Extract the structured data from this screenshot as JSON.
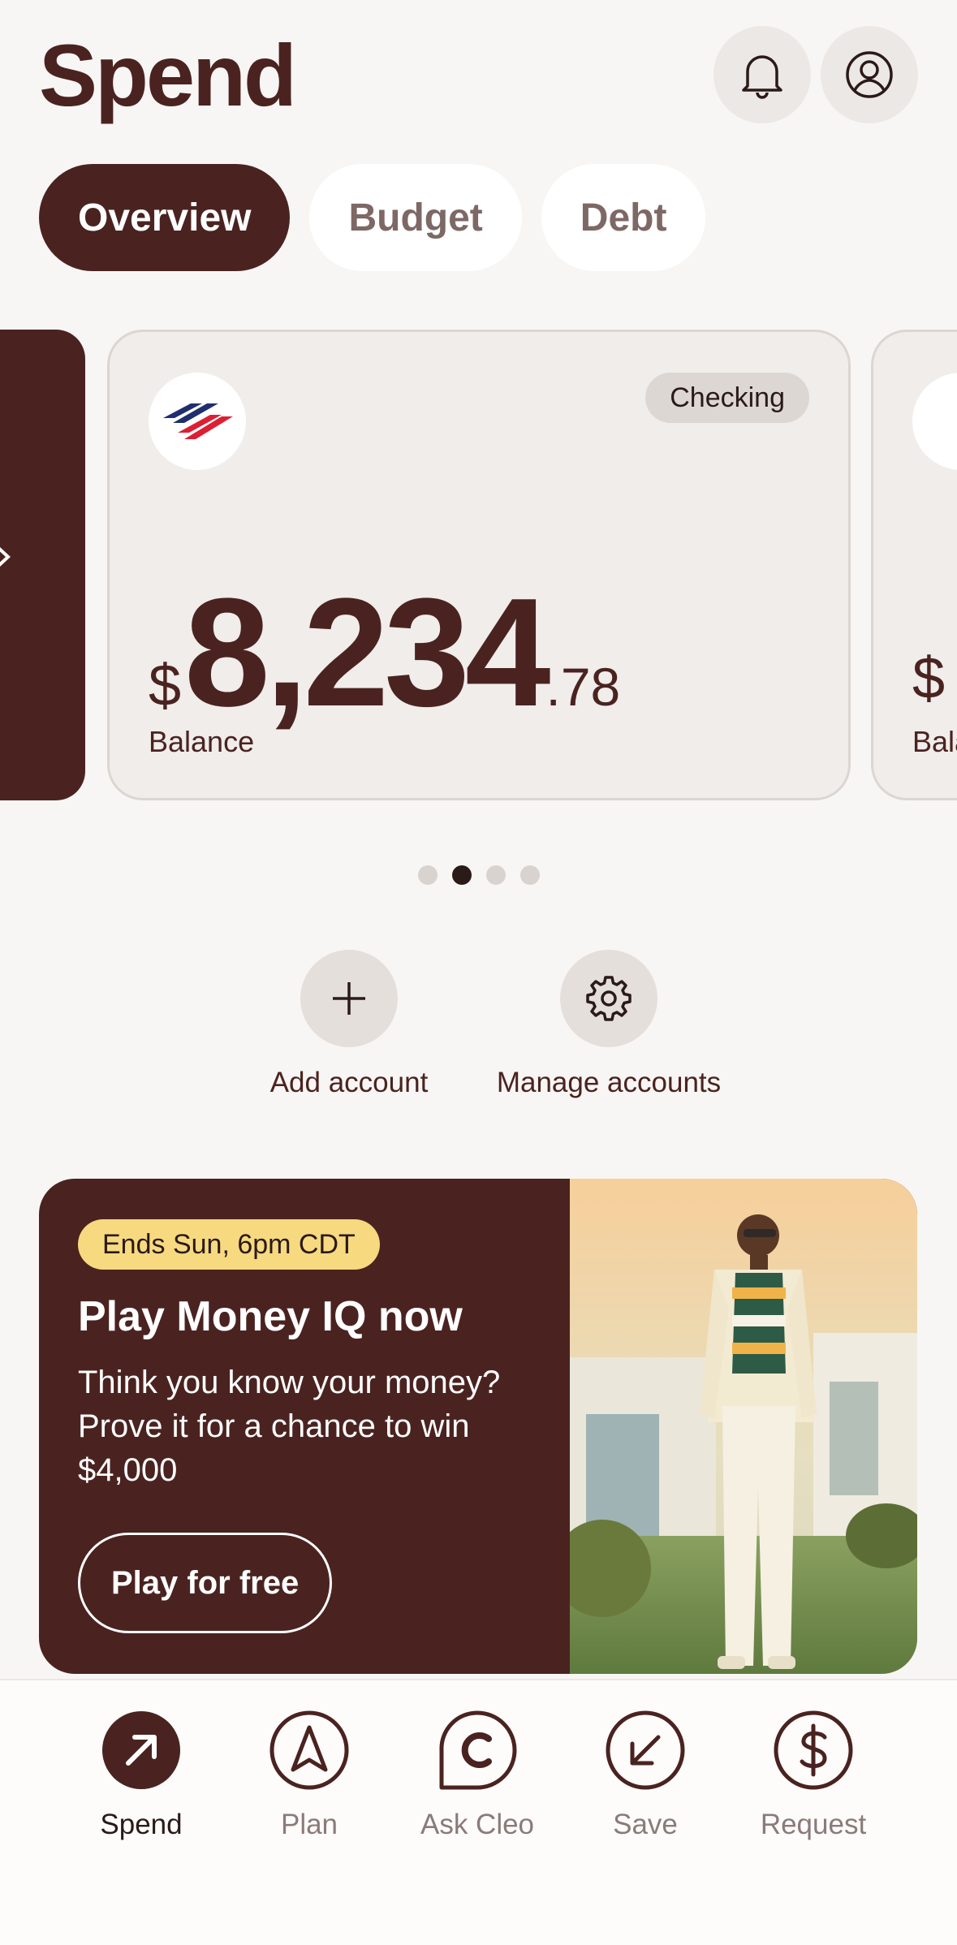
{
  "header": {
    "title": "Spend",
    "icons": {
      "notifications": "bell-icon",
      "profile": "profile-icon"
    }
  },
  "tabs": [
    {
      "label": "Overview",
      "active": true
    },
    {
      "label": "Budget",
      "active": false
    },
    {
      "label": "Debt",
      "active": false
    }
  ],
  "account_card": {
    "type_badge": "Checking",
    "currency": "$",
    "balance_whole": "8,234",
    "balance_cents": ".78",
    "balance_label": "Balance",
    "bank_logo": "bank-of-america-logo"
  },
  "next_card_peek": {
    "currency": "$",
    "balance_label": "Balance"
  },
  "carousel": {
    "page_count": 4,
    "active_index": 1
  },
  "actions": {
    "add_account": "Add account",
    "manage_accounts": "Manage accounts"
  },
  "promo": {
    "badge": "Ends Sun, 6pm CDT",
    "title": "Play Money IQ now",
    "body": "Think you know your money? Prove it for a chance to win $4,000",
    "cta": "Play for free"
  },
  "bottom_nav": [
    {
      "label": "Spend",
      "icon": "arrow-up-right-icon",
      "active": true
    },
    {
      "label": "Plan",
      "icon": "navigation-arrow-icon",
      "active": false
    },
    {
      "label": "Ask Cleo",
      "icon": "cleo-chat-icon",
      "active": false
    },
    {
      "label": "Save",
      "icon": "arrow-down-left-icon",
      "active": false
    },
    {
      "label": "Request",
      "icon": "dollar-icon",
      "active": false
    }
  ],
  "colors": {
    "brand": "#4a2320",
    "background": "#f8f6f4",
    "badge_yellow": "#f7d980"
  }
}
